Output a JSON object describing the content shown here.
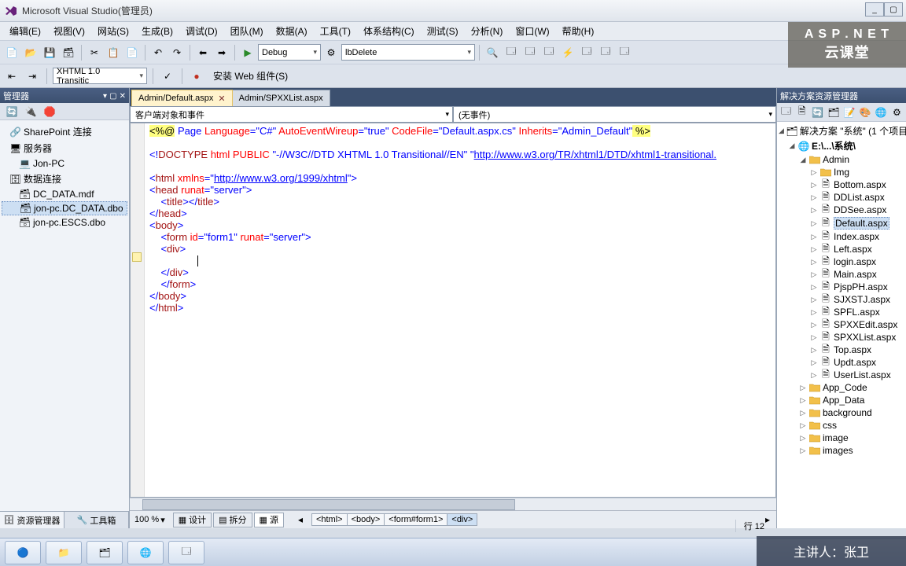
{
  "title": "Microsoft Visual Studio(管理员)",
  "menu": [
    "编辑(E)",
    "视图(V)",
    "网站(S)",
    "生成(B)",
    "调试(D)",
    "团队(M)",
    "数据(A)",
    "工具(T)",
    "体系结构(C)",
    "测试(S)",
    "分析(N)",
    "窗口(W)",
    "帮助(H)"
  ],
  "tb1": {
    "config": "Debug",
    "target": "lbDelete"
  },
  "tb2": {
    "doctype": "XHTML 1.0 Transitic",
    "webcomp": "安装 Web 组件(S)"
  },
  "left": {
    "header": "管理器",
    "items": [
      {
        "label": "SharePoint 连接",
        "icon": "link",
        "sel": false
      },
      {
        "label": "服务器",
        "icon": "server",
        "sel": false
      },
      {
        "label": "Jon-PC",
        "icon": "pc",
        "sel": false
      },
      {
        "label": "数据连接",
        "icon": "db",
        "sel": false
      },
      {
        "label": "DC_DATA.mdf",
        "icon": "dbfile",
        "sel": false
      },
      {
        "label": "jon-pc.DC_DATA.dbo",
        "icon": "dbconn",
        "sel": true
      },
      {
        "label": "jon-pc.ESCS.dbo",
        "icon": "dbconn",
        "sel": false
      }
    ],
    "tabs": [
      "资源管理器",
      "工具箱"
    ]
  },
  "docs": {
    "tabs": [
      {
        "label": "Admin/Default.aspx",
        "active": true
      },
      {
        "label": "Admin/SPXXList.aspx",
        "active": false
      }
    ],
    "sub": [
      "客户端对象和事件",
      "(无事件)"
    ],
    "zoom": "100 %",
    "views": [
      "设计",
      "拆分",
      "源"
    ],
    "crumbs": [
      "<html>",
      "<body>",
      "<form#form1>",
      "<div>"
    ]
  },
  "code": {
    "l1a": "<%@",
    "l1b": " Page ",
    "l1c": "Language",
    "l1d": "=\"C#\"",
    "l1e": " AutoEventWireup",
    "l1f": "=\"true\"",
    "l1g": " CodeFile",
    "l1h": "=\"Default.aspx.cs\"",
    "l1i": " Inherits",
    "l1j": "=\"Admin_Default\"",
    "l1k": " %>",
    "l3a": "<!",
    "l3b": "DOCTYPE ",
    "l3c": "html ",
    "l3d": "PUBLIC ",
    "l3e": "\"-//W3C//DTD XHTML 1.0 Transitional//EN\" \"",
    "l3f": "http://www.w3.org/TR/xhtml1/DTD/xhtml1-transitional.",
    "l5a": "<",
    "l5b": "html ",
    "l5c": "xmlns",
    "l5d": "=\"",
    "l5e": "http://www.w3.org/1999/xhtml",
    "l5f": "\">",
    "l6a": "<",
    "l6b": "head ",
    "l6c": "runat",
    "l6d": "=\"server\">",
    "l7a": "    <",
    "l7b": "title",
    "l7c": "></",
    "l7d": "title",
    "l7e": ">",
    "l8a": "</",
    "l8b": "head",
    "l8c": ">",
    "l9a": "<",
    "l9b": "body",
    "l9c": ">",
    "l10a": "    <",
    "l10b": "form ",
    "l10c": "id",
    "l10d": "=\"form1\" ",
    "l10e": "runat",
    "l10f": "=\"server\">",
    "l11a": "    <",
    "l11b": "div",
    "l11c": ">",
    "l12": "        ",
    "l13a": "    </",
    "l13b": "div",
    "l13c": ">",
    "l14a": "    </",
    "l14b": "form",
    "l14c": ">",
    "l15a": "</",
    "l15b": "body",
    "l15c": ">",
    "l16a": "</",
    "l16b": "html",
    "l16c": ">"
  },
  "right": {
    "header": "解决方案资源管理器",
    "sol": "解决方案 \"系统\" (1 个项目",
    "proj": "E:\\...\\系统\\",
    "folders": [
      "Admin"
    ],
    "admin_sub": [
      "Img"
    ],
    "admin_files": [
      "Bottom.aspx",
      "DDList.aspx",
      "DDSee.aspx",
      "Default.aspx",
      "Index.aspx",
      "Left.aspx",
      "login.aspx",
      "Main.aspx",
      "PjspPH.aspx",
      "SJXSTJ.aspx",
      "SPFL.aspx",
      "SPXXEdit.aspx",
      "SPXXList.aspx",
      "Top.aspx",
      "Updt.aspx",
      "UserList.aspx"
    ],
    "root_folders": [
      "App_Code",
      "App_Data",
      "background",
      "css",
      "image",
      "images"
    ]
  },
  "status": {
    "line": "行 12"
  },
  "brand": {
    "top": "A S P . N E T",
    "sub": "云课堂"
  },
  "present": "主讲人：张卫"
}
